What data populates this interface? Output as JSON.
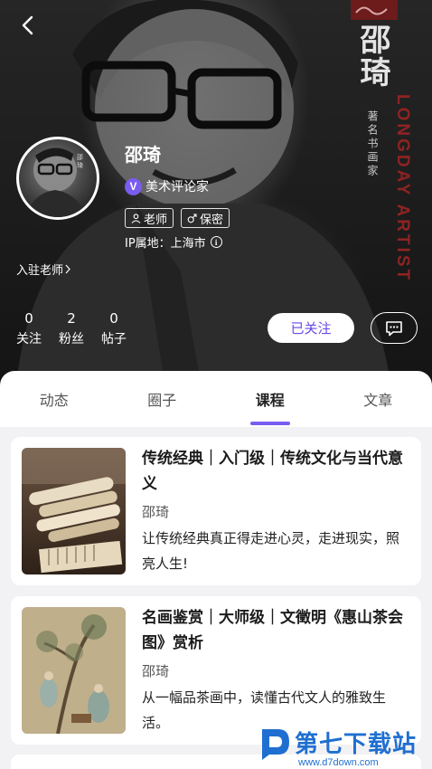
{
  "hero": {
    "calligraphy": "邵琦",
    "subtitle": "著名书画家",
    "english": "LONGDAY ARTIST"
  },
  "profile": {
    "name": "邵琦",
    "verified_badge": "V",
    "title": "美术评论家",
    "tags": [
      {
        "icon": "person-icon",
        "label": "老师"
      },
      {
        "icon": "male-icon",
        "label": "保密"
      }
    ],
    "ip_location": "IP属地：上海市",
    "settled_link": "入驻老师"
  },
  "stats": [
    {
      "value": "0",
      "label": "关注"
    },
    {
      "value": "2",
      "label": "粉丝"
    },
    {
      "value": "0",
      "label": "帖子"
    }
  ],
  "actions": {
    "follow_label": "已关注"
  },
  "tabs": [
    {
      "label": "动态",
      "active": false
    },
    {
      "label": "圈子",
      "active": false
    },
    {
      "label": "课程",
      "active": true
    },
    {
      "label": "文章",
      "active": false
    }
  ],
  "courses": [
    {
      "title": "传统经典｜入门级｜传统文化与当代意义",
      "author": "邵琦",
      "description": "让传统经典真正得走进心灵，走进现实，照亮人生!"
    },
    {
      "title": "名画鉴赏｜大师级｜文徵明《惠山茶会图》赏析",
      "author": "邵琦",
      "description": "从一幅品茶画中，读懂古代文人的雅致生活。"
    }
  ],
  "watermark": {
    "text": "第七下载站",
    "url": "www.d7down.com"
  },
  "colors": {
    "accent": "#7a5cf0",
    "follow_text": "#6b48e8",
    "watermark": "#1f6fd1"
  }
}
